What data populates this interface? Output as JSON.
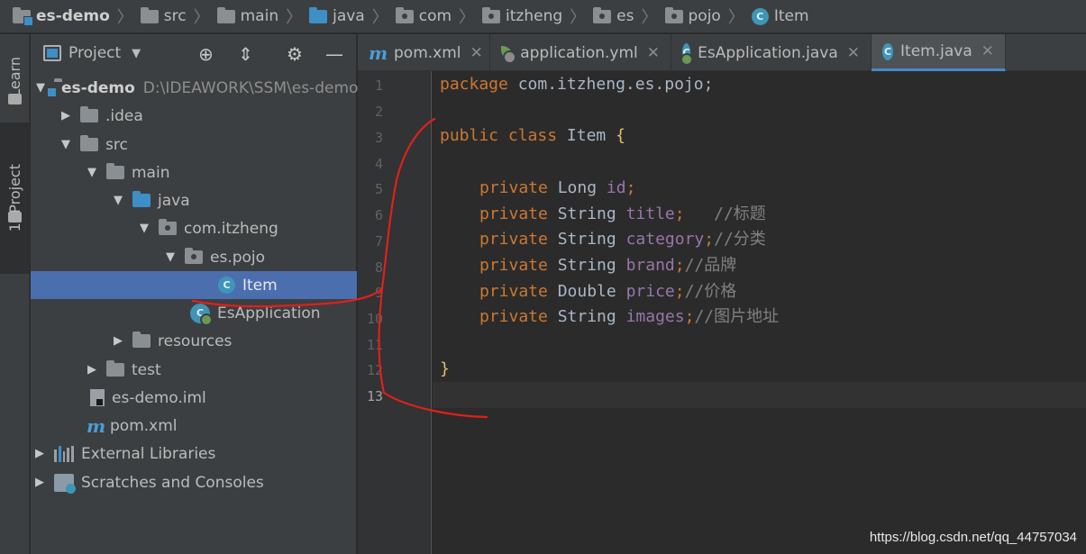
{
  "breadcrumb": [
    "es-demo",
    "src",
    "main",
    "java",
    "com",
    "itzheng",
    "es",
    "pojo",
    "Item"
  ],
  "toolstrip": {
    "learn": "Learn",
    "project": "1: Project"
  },
  "project_panel": {
    "title": "Project",
    "tree": [
      {
        "label": "es-demo",
        "path": "D:\\IDEAWORK\\SSM\\es-demo"
      },
      {
        "label": ".idea"
      },
      {
        "label": "src"
      },
      {
        "label": "main"
      },
      {
        "label": "java"
      },
      {
        "label": "com.itzheng"
      },
      {
        "label": "es.pojo"
      },
      {
        "label": "Item"
      },
      {
        "label": "EsApplication"
      },
      {
        "label": "resources"
      },
      {
        "label": "test"
      },
      {
        "label": "es-demo.iml"
      },
      {
        "label": "pom.xml"
      },
      {
        "label": "External Libraries"
      },
      {
        "label": "Scratches and Consoles"
      }
    ]
  },
  "tabs": [
    "pom.xml",
    "application.yml",
    "EsApplication.java",
    "Item.java"
  ],
  "editor": {
    "line_numbers": [
      "1",
      "2",
      "3",
      "4",
      "5",
      "6",
      "7",
      "8",
      "9",
      "10",
      "11",
      "12",
      "13"
    ],
    "lines": [
      {
        "kw": "package ",
        "rest": "com.itzheng.es.pojo;"
      },
      {
        "kw": "",
        "rest": ""
      },
      {
        "kw": "public class ",
        "rest": "Item ",
        "brace": "{"
      },
      {
        "kw": "",
        "rest": ""
      },
      {
        "kw": "private ",
        "type": "Long ",
        "field": "id",
        "end": ";"
      },
      {
        "kw": "private ",
        "type": "String ",
        "field": "title",
        "end": ";   ",
        "comment": "//标题"
      },
      {
        "kw": "private ",
        "type": "String ",
        "field": "category",
        "end": ";",
        "comment": "//分类"
      },
      {
        "kw": "private ",
        "type": "String ",
        "field": "brand",
        "end": ";",
        "comment": "//品牌"
      },
      {
        "kw": "private ",
        "type": "Double ",
        "field": "price",
        "end": ";",
        "comment": "//价格"
      },
      {
        "kw": "private ",
        "type": "String ",
        "field": "images",
        "end": ";",
        "comment": "//图片地址"
      },
      {
        "kw": "",
        "rest": ""
      },
      {
        "kw": "",
        "rest": "",
        "brace": "}"
      },
      {
        "kw": "",
        "rest": ""
      }
    ]
  },
  "watermark": "https://blog.csdn.net/qq_44757034",
  "colors": {
    "selection": "#4b6eaf",
    "keyword": "#cc7832",
    "field": "#9876aa",
    "comment": "#808080",
    "annotation": "#e0201a"
  }
}
